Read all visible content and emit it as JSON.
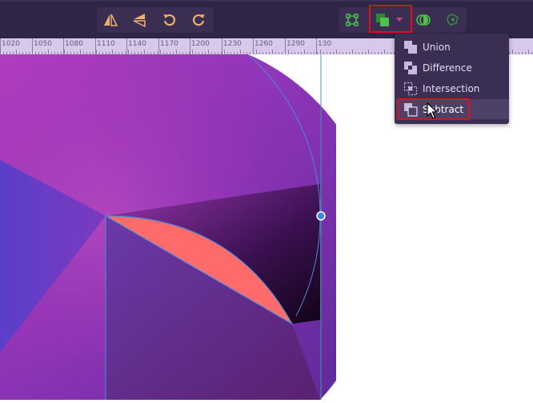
{
  "toolbar": {
    "tools_left": [
      {
        "name": "flip-horizontal-icon"
      },
      {
        "name": "flip-vertical-icon"
      },
      {
        "name": "rotate-counterclockwise-icon"
      },
      {
        "name": "rotate-clockwise-icon"
      }
    ],
    "tools_right": [
      {
        "name": "path-edit-icon"
      },
      {
        "name": "boolean-operations-icon"
      },
      {
        "name": "dropdown-arrow-icon"
      },
      {
        "name": "mask-icon"
      },
      {
        "name": "align-distribute-icon"
      }
    ]
  },
  "ruler": {
    "labels": [
      "1020",
      "1050",
      "1080",
      "1110",
      "1140",
      "1170",
      "1200",
      "1230",
      "1260",
      "1290",
      "130"
    ]
  },
  "menu": {
    "items": [
      {
        "label": "Union",
        "icon": "union-icon"
      },
      {
        "label": "Difference",
        "icon": "difference-icon"
      },
      {
        "label": "Intersection",
        "icon": "intersection-icon"
      },
      {
        "label": "Subtract",
        "icon": "subtract-icon",
        "hover": true
      }
    ]
  },
  "colors": {
    "toolbar_bg": "#2f2545",
    "menu_bg": "#3a2f52",
    "accent_green": "#4cc24c",
    "highlight_red": "#e0101a",
    "tool_orange": "#f0b070",
    "subtract_wedge": "#ff6b6b"
  }
}
